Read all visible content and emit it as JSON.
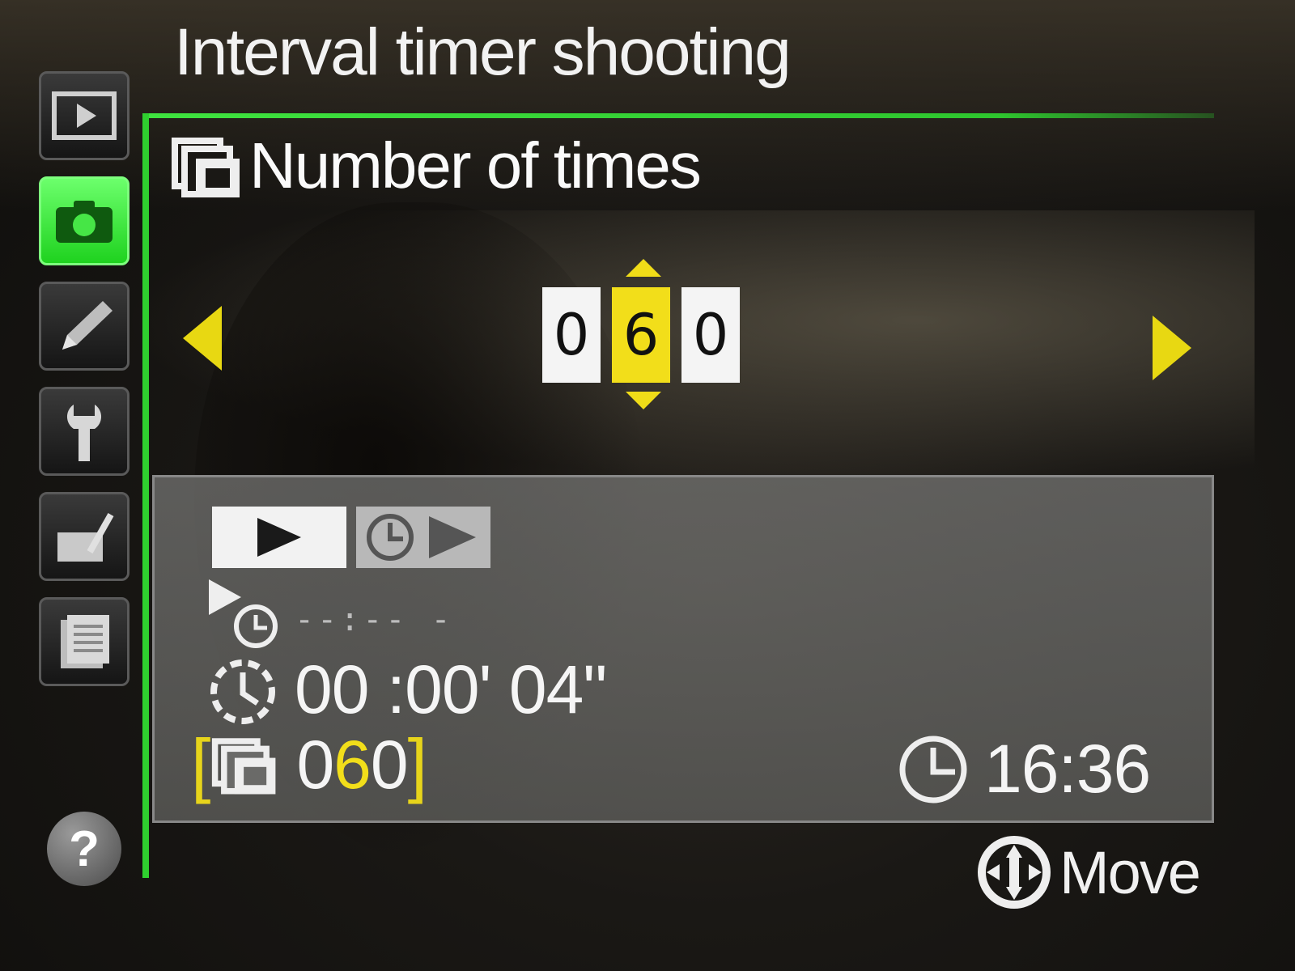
{
  "title": "Interval timer shooting",
  "heading": {
    "label": "Number of times"
  },
  "digits": {
    "d1": "0",
    "d2": "6",
    "d3": "0",
    "selected_index": 1
  },
  "info": {
    "start_time": "--:-- -",
    "interval": "00 :00' 04\"",
    "count": "060",
    "clock": "16:36"
  },
  "footer": {
    "move_label": "Move"
  },
  "help": {
    "symbol": "?"
  },
  "menu_tabs": [
    {
      "icon": "playback-icon",
      "active": false
    },
    {
      "icon": "camera-icon",
      "active": true
    },
    {
      "icon": "pencil-icon",
      "active": false
    },
    {
      "icon": "wrench-icon",
      "active": false
    },
    {
      "icon": "retouch-icon",
      "active": false
    },
    {
      "icon": "recent-settings-icon",
      "active": false
    }
  ],
  "colors": {
    "accent_green": "#2fcf2f",
    "highlight_yellow": "#f2de1a"
  }
}
